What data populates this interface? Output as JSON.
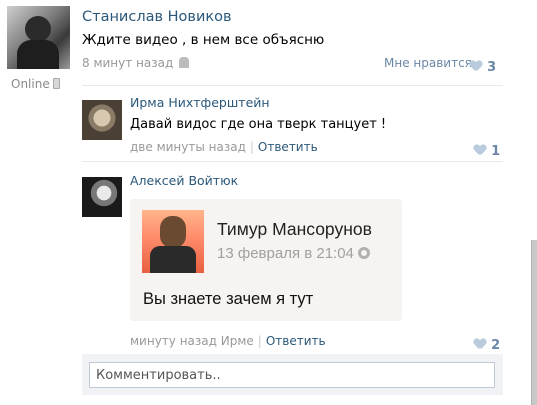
{
  "post": {
    "author": "Станислав Новиков",
    "text": "Ждите видео , в нем все объясню",
    "time": "8 минут назад",
    "online_label": "Online",
    "like_label": "Мне нравится",
    "like_count": "3"
  },
  "comments": [
    {
      "author": "Ирма Нихтферштейн",
      "text": "Давай видос где она тверк танцует !",
      "time": "две минуты назад",
      "reply_label": "Ответить",
      "like_count": "1"
    },
    {
      "author": "Алексей Войтюк",
      "time": "минуту назад Ирме",
      "reply_label": "Ответить",
      "like_count": "2",
      "attachment": {
        "name": "Тимур Мансорунов",
        "date": "13 февраля в 21:04",
        "message": "Вы знаете зачем я тут"
      }
    }
  ],
  "reply_box": {
    "placeholder": "Комментировать.."
  },
  "colors": {
    "link": "#2b587a",
    "meta": "#999999",
    "like": "#6a87a6"
  }
}
